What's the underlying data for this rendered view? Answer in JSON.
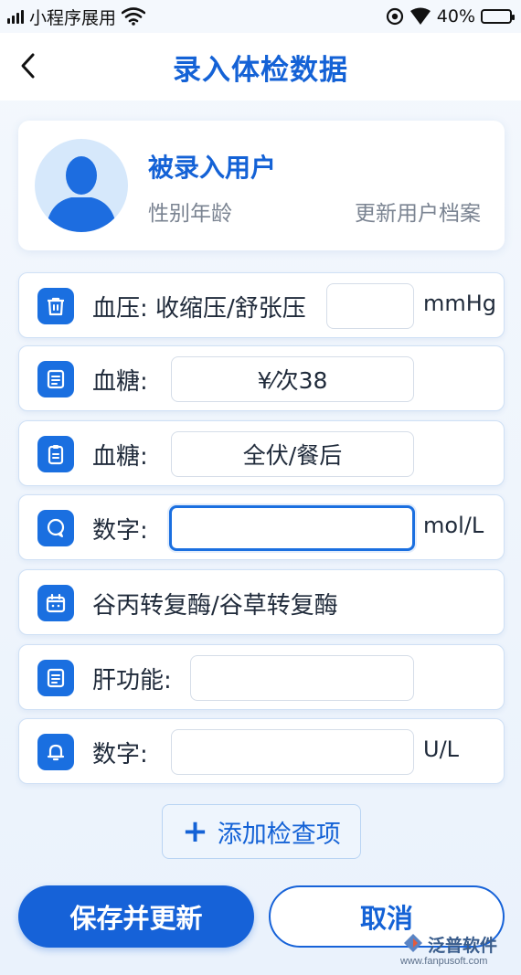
{
  "status_bar": {
    "carrier": "小程序展用",
    "battery": "40%",
    "battery_level": 0.4
  },
  "nav": {
    "title": "录入体检数据"
  },
  "user_card": {
    "name": "被录入用户",
    "meta": "性别年龄",
    "update_link": "更新用户档案"
  },
  "rows": [
    {
      "icon": "trash-icon",
      "label": "血压: 收缩压/舒张压",
      "value": "",
      "unit": "mmHg"
    },
    {
      "icon": "document-icon",
      "label": "血糖:",
      "value": "¥⁄次38",
      "unit": ""
    },
    {
      "icon": "clipboard-icon",
      "label": "血糖:",
      "value": "全伏/餐后",
      "unit": ""
    },
    {
      "icon": "chat-bubble-icon",
      "label": "数字:",
      "value": "",
      "unit": "mol/L"
    },
    {
      "icon": "calendar-icon",
      "label": "谷丙转复酶/谷草转复酶",
      "value": "",
      "unit": ""
    },
    {
      "icon": "document-icon",
      "label": "肝功能:",
      "value": "",
      "unit": ""
    },
    {
      "icon": "bell-icon",
      "label": "数字:",
      "value": "",
      "unit": "U/L"
    }
  ],
  "actions": {
    "add_item": "添加检查项",
    "save": "保存并更新",
    "cancel": "取消"
  },
  "watermark": {
    "brand": "泛普软件",
    "url": "www.fanpusoft.com"
  },
  "colors": {
    "accent": "#1662d8",
    "title": "#1462d6",
    "muted": "#7b8492"
  }
}
